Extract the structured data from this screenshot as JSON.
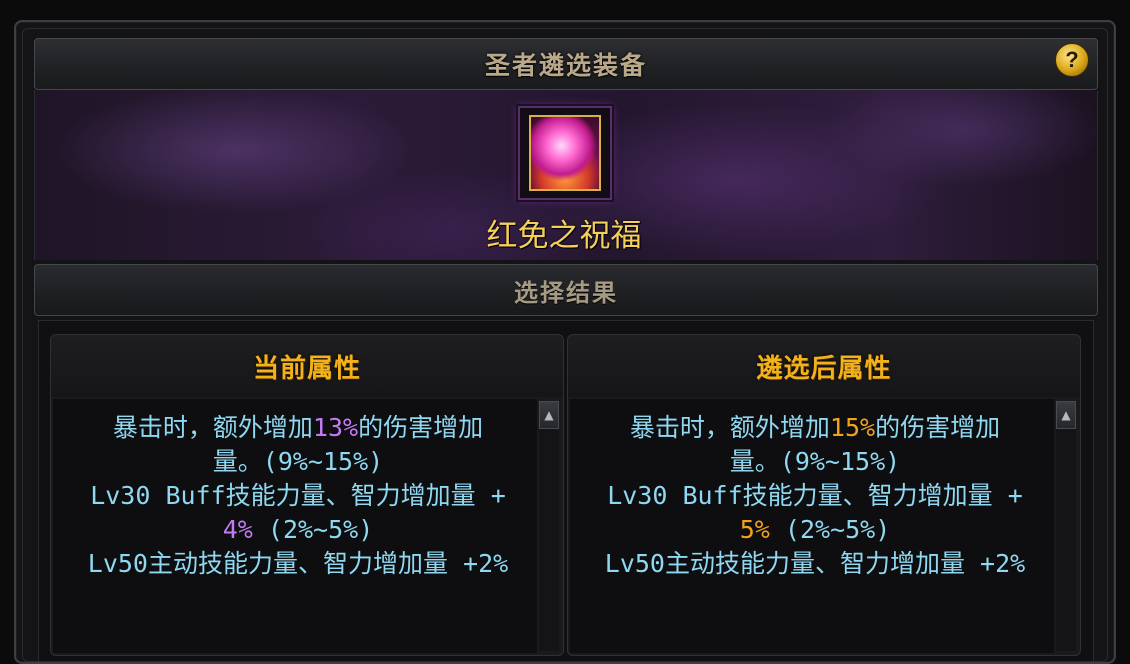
{
  "window": {
    "title": "圣者遴选装备",
    "help_label": "?"
  },
  "item": {
    "name": "红免之祝福",
    "icon": "red-rabbit-blessing-icon"
  },
  "result_section": {
    "title": "选择结果"
  },
  "current_panel": {
    "title": "当前属性",
    "lines": [
      {
        "pre": "暴击时，额外增加",
        "value": "13%",
        "post": "的伤害增加"
      },
      {
        "text": "量。(9%~15%)"
      },
      {
        "text": "Lv30 Buff技能力量、智力增加量 +"
      },
      {
        "value": "4%",
        "post": " (2%~5%)"
      },
      {
        "text": "Lv50主动技能力量、智力增加量 +2%"
      }
    ],
    "value_color": "#c27bf5"
  },
  "after_panel": {
    "title": "遴选后属性",
    "lines": [
      {
        "pre": "暴击时，额外增加",
        "value": "15%",
        "post": "的伤害增加"
      },
      {
        "text": "量。(9%~15%)"
      },
      {
        "text": "Lv30 Buff技能力量、智力增加量 +"
      },
      {
        "value": "5%",
        "post": " (2%~5%)"
      },
      {
        "text": "Lv50主动技能力量、智力增加量 +2%"
      }
    ],
    "value_color": "#f4a21c"
  },
  "colors": {
    "text_cyan": "#8fd8f2",
    "title_gold": "#f3b21a",
    "item_name_gold": "#f5cf5a"
  }
}
